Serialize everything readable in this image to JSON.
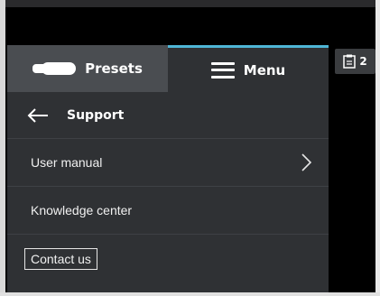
{
  "tabs": {
    "presets_label": "Presets",
    "menu_label": "Menu",
    "active": "menu"
  },
  "support": {
    "title": "Support",
    "items": [
      {
        "label": "User manual",
        "has_chevron": true
      },
      {
        "label": "Knowledge center",
        "has_chevron": false
      }
    ],
    "contact_label": "Contact us"
  },
  "badge": {
    "icon": "clipboard-icon",
    "count": "2"
  },
  "colors": {
    "panel_bg": "#2f3134",
    "tab_inactive": "#4a4d51",
    "accent": "#4fb6d6"
  }
}
